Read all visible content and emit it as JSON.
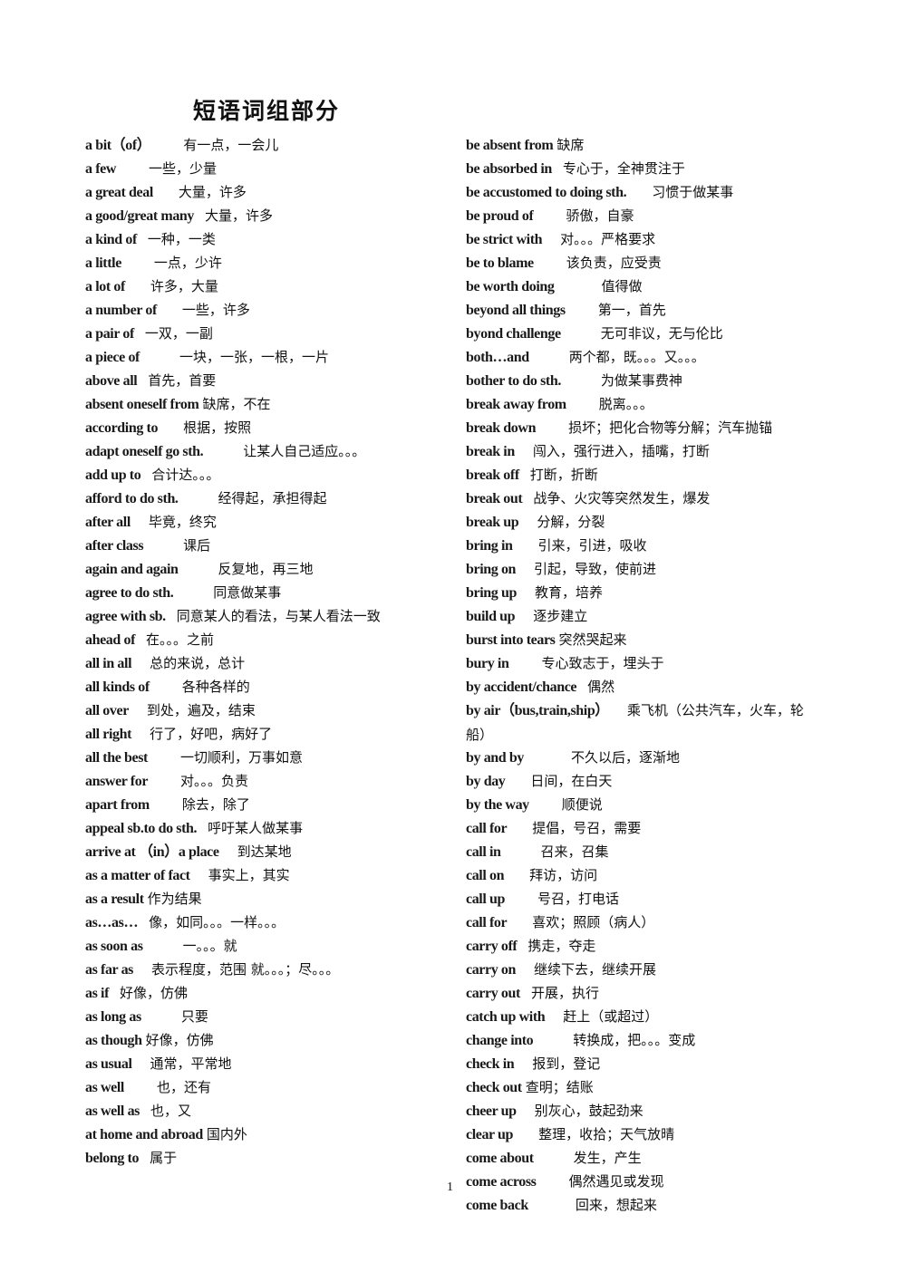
{
  "document": {
    "title": "短语词组部分",
    "page_number": "1"
  },
  "left_column": [
    {
      "phrase": "a bit（of）",
      "definition": "有一点，一会儿",
      "gap": 4
    },
    {
      "phrase": "a few",
      "definition": "一些，少量",
      "gap": 4
    },
    {
      "phrase": "a great deal",
      "definition": "大量，许多",
      "gap": 3
    },
    {
      "phrase": "a good/great many",
      "definition": "大量，许多",
      "gap": 1
    },
    {
      "phrase": "a kind of",
      "definition": "一种，一类",
      "gap": 1
    },
    {
      "phrase": "a little",
      "definition": "一点，少许",
      "gap": 4
    },
    {
      "phrase": "a lot of",
      "definition": "许多，大量",
      "gap": 3
    },
    {
      "phrase": "a number of",
      "definition": "一些，许多",
      "gap": 3
    },
    {
      "phrase": "a pair of",
      "definition": "一双，一副",
      "gap": 1
    },
    {
      "phrase": "a piece of",
      "definition": "一块，一张，一根，一片",
      "gap": 5
    },
    {
      "phrase": "above all",
      "definition": "首先，首要",
      "gap": 1
    },
    {
      "phrase": "absent oneself from",
      "definition": "缺席，不在",
      "gap": 0
    },
    {
      "phrase": "according to",
      "definition": "根据，按照",
      "gap": 3
    },
    {
      "phrase": "adapt oneself go sth.",
      "definition": "让某人自己适应。。。",
      "gap": 5
    },
    {
      "phrase": "add up to",
      "definition": "合计达。。。",
      "gap": 1
    },
    {
      "phrase": "afford to do sth.",
      "definition": "经得起，承担得起",
      "gap": 5
    },
    {
      "phrase": "after all",
      "definition": "毕竟，终究",
      "gap": 2
    },
    {
      "phrase": "after class",
      "definition": "课后",
      "gap": 5
    },
    {
      "phrase": "again and again",
      "definition": "反复地，再三地",
      "gap": 5
    },
    {
      "phrase": "agree to do sth.",
      "definition": "同意做某事",
      "gap": 5
    },
    {
      "phrase": "agree with sb.",
      "definition": "同意某人的看法，与某人看法一致",
      "gap": 1
    },
    {
      "phrase": "ahead of",
      "definition": "在。。。之前",
      "gap": 1
    },
    {
      "phrase": "all in all",
      "definition": "总的来说，总计",
      "gap": 2
    },
    {
      "phrase": "all kinds of",
      "definition": "各种各样的",
      "gap": 4
    },
    {
      "phrase": "all over",
      "definition": "到处，遍及，结束",
      "gap": 2
    },
    {
      "phrase": "all right",
      "definition": "行了，好吧，病好了",
      "gap": 2
    },
    {
      "phrase": "all the best",
      "definition": "一切顺利，万事如意",
      "gap": 4
    },
    {
      "phrase": "answer for",
      "definition": "对。。。负责",
      "gap": 4
    },
    {
      "phrase": "apart from",
      "definition": "除去，除了",
      "gap": 4
    },
    {
      "phrase": "appeal sb.to do sth.",
      "definition": "呼吁某人做某事",
      "gap": 1
    },
    {
      "phrase": "arrive at （in）a place",
      "definition": "到达某地",
      "gap": 2
    },
    {
      "phrase": "as a matter of fact",
      "definition": "事实上，其实",
      "gap": 2
    },
    {
      "phrase": "as a result",
      "definition": "作为结果",
      "gap": 0
    },
    {
      "phrase": "as…as…",
      "definition": "像，如同。。。一样。。。",
      "gap": 1
    },
    {
      "phrase": "as soon as",
      "definition": "一。。。就",
      "gap": 5
    },
    {
      "phrase": "as far as",
      "definition": "表示程度，范围 就。。。；尽。。。",
      "gap": 2
    },
    {
      "phrase": "as if",
      "definition": "好像，仿佛",
      "gap": 1
    },
    {
      "phrase": "as long as",
      "definition": "只要",
      "gap": 5
    },
    {
      "phrase": "as though",
      "definition": "好像，仿佛",
      "gap": 0
    },
    {
      "phrase": "as usual",
      "definition": "通常，平常地",
      "gap": 2
    },
    {
      "phrase": "as well",
      "definition": "也，还有",
      "gap": 4
    },
    {
      "phrase": "as well as",
      "definition": "也，又",
      "gap": 1
    },
    {
      "phrase": "at home and abroad",
      "definition": "国内外",
      "gap": 0
    },
    {
      "phrase": "belong to",
      "definition": "属于",
      "gap": 1
    }
  ],
  "right_column": [
    {
      "phrase": "be absent from",
      "definition": "缺席",
      "gap": 0
    },
    {
      "phrase": "be absorbed in",
      "definition": "专心于，全神贯注于",
      "gap": 1
    },
    {
      "phrase": "be accustomed to doing sth.",
      "definition": "习惯于做某事",
      "gap": 3
    },
    {
      "phrase": "be proud of",
      "definition": "骄傲，自豪",
      "gap": 4
    },
    {
      "phrase": "be strict with",
      "definition": "对。。。严格要求",
      "gap": 2
    },
    {
      "phrase": "be to blame",
      "definition": "该负责，应受责",
      "gap": 4
    },
    {
      "phrase": "be worth doing",
      "definition": "值得做",
      "gap": 6
    },
    {
      "phrase": "beyond all things",
      "definition": "第一，首先",
      "gap": 4
    },
    {
      "phrase": "byond challenge",
      "definition": "无可非议，无与伦比",
      "gap": 5
    },
    {
      "phrase": "both…and",
      "definition": "两个都，既。。。又。。。",
      "gap": 5
    },
    {
      "phrase": "bother to do sth.",
      "definition": "为做某事费神",
      "gap": 5
    },
    {
      "phrase": "break away from",
      "definition": "脱离。。。",
      "gap": 4
    },
    {
      "phrase": "break down",
      "definition": "损坏；把化合物等分解；汽车抛锚",
      "gap": 4
    },
    {
      "phrase": "break in",
      "definition": "闯入，强行进入，插嘴，打断",
      "gap": 2
    },
    {
      "phrase": "break off",
      "definition": "打断，折断",
      "gap": 1
    },
    {
      "phrase": "break out",
      "definition": "战争、火灾等突然发生，爆发",
      "gap": 1
    },
    {
      "phrase": "break up",
      "definition": "分解，分裂",
      "gap": 2
    },
    {
      "phrase": "bring in",
      "definition": "引来，引进，吸收",
      "gap": 3
    },
    {
      "phrase": "bring on",
      "definition": "引起，导致，使前进",
      "gap": 2
    },
    {
      "phrase": "bring up",
      "definition": "教育，培养",
      "gap": 2
    },
    {
      "phrase": "build up",
      "definition": "逐步建立",
      "gap": 2
    },
    {
      "phrase": "burst into tears",
      "definition": "突然哭起来",
      "gap": 0
    },
    {
      "phrase": "bury in",
      "definition": "专心致志于，埋头于",
      "gap": 4
    },
    {
      "phrase": "by accident/chance",
      "definition": "偶然",
      "gap": 1
    },
    {
      "phrase": "by air（bus,train,ship）",
      "definition": "乘飞机（公共汽车，火车，轮船）",
      "gap": 2,
      "wrap": true
    },
    {
      "phrase": "by and by",
      "definition": "不久以后，逐渐地",
      "gap": 6
    },
    {
      "phrase": "by day",
      "definition": "日间，在白天",
      "gap": 3
    },
    {
      "phrase": "by the way",
      "definition": "顺便说",
      "gap": 4
    },
    {
      "phrase": "call for",
      "definition": "提倡，号召，需要",
      "gap": 3
    },
    {
      "phrase": "call in",
      "definition": "召来，召集",
      "gap": 5
    },
    {
      "phrase": "call on",
      "definition": "拜访，访问",
      "gap": 3
    },
    {
      "phrase": "call up",
      "definition": "号召，打电话",
      "gap": 4
    },
    {
      "phrase": "call for",
      "definition": "喜欢；照顾（病人）",
      "gap": 3
    },
    {
      "phrase": "carry off",
      "definition": "携走，夺走",
      "gap": 1
    },
    {
      "phrase": "carry on",
      "definition": "继续下去，继续开展",
      "gap": 2
    },
    {
      "phrase": "carry out",
      "definition": "开展，执行",
      "gap": 1
    },
    {
      "phrase": "catch up with",
      "definition": "赶上（或超过）",
      "gap": 2
    },
    {
      "phrase": "change into",
      "definition": "转换成，把。。。变成",
      "gap": 5
    },
    {
      "phrase": "check in",
      "definition": "报到，登记",
      "gap": 2
    },
    {
      "phrase": "check out",
      "definition": "查明；结账",
      "gap": 0
    },
    {
      "phrase": "cheer up",
      "definition": "别灰心，鼓起劲来",
      "gap": 2
    },
    {
      "phrase": "clear up",
      "definition": "整理，收拾；天气放晴",
      "gap": 3
    },
    {
      "phrase": "come about",
      "definition": "发生，产生",
      "gap": 5
    },
    {
      "phrase": "come across",
      "definition": "偶然遇见或发现",
      "gap": 4
    },
    {
      "phrase": "come back",
      "definition": "回来，想起来",
      "gap": 6
    }
  ]
}
